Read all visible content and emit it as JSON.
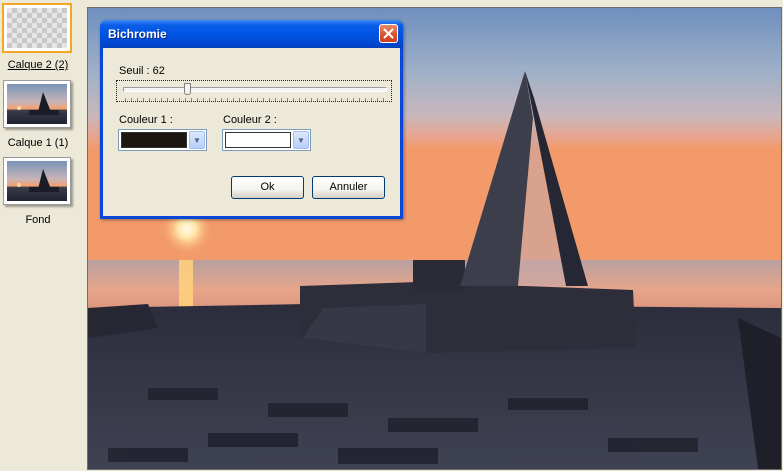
{
  "layers_panel": {
    "layers": [
      {
        "label": "Calque 2 (2)",
        "thumbnail": "transparent-checkerboard",
        "selected": true
      },
      {
        "label": "Calque 1 (1)",
        "thumbnail": "sunset-monument-photo",
        "selected": false
      },
      {
        "label": "Fond",
        "thumbnail": "sunset-monument-photo",
        "selected": false
      }
    ]
  },
  "canvas": {
    "content": "sunset-monument-photo"
  },
  "dialog": {
    "title": "Bichromie",
    "close_icon": "close-icon",
    "threshold": {
      "label": "Seuil : 62",
      "value": 62,
      "min": 0,
      "max": 255
    },
    "color1": {
      "label": "Couleur 1 :",
      "value": "#1c1610"
    },
    "color2": {
      "label": "Couleur 2 :",
      "value": "#ffffff"
    },
    "dropdown_icon": "chevron-down-icon",
    "ok_label": "Ok",
    "cancel_label": "Annuler"
  },
  "colors": {
    "titlebar": "#0054e3",
    "selection_border": "#f5a623",
    "window_bg": "#ece9d8",
    "close_button": "#d8522a"
  }
}
